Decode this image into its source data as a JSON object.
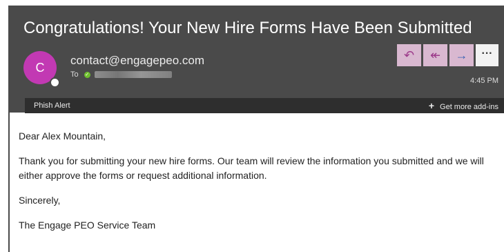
{
  "email": {
    "subject": "Congratulations! Your New Hire Forms Have Been Submitted",
    "avatar_initial": "C",
    "sender": "contact@engagepeo.com",
    "to_label": "To",
    "time": "4:45 PM",
    "icons": {
      "reply": "reply-icon",
      "reply_all": "reply-all-icon",
      "forward": "forward-icon",
      "more": "more-icon",
      "verified": "verified-check-icon",
      "add": "plus-icon"
    },
    "colors": {
      "header_bg": "#4a4a4a",
      "avatar": "#c239b3",
      "action_button": "#d9b8d0"
    }
  },
  "addins": {
    "phish_alert": "Phish Alert",
    "get_more": "Get more add-ins"
  },
  "body": {
    "greeting": "Dear Alex Mountain,",
    "paragraph": "Thank you for submitting your new hire forms. Our team will review the information you submitted and we will either approve the forms or request additional information.",
    "closing": "Sincerely,",
    "signature": "The Engage PEO Service Team"
  }
}
